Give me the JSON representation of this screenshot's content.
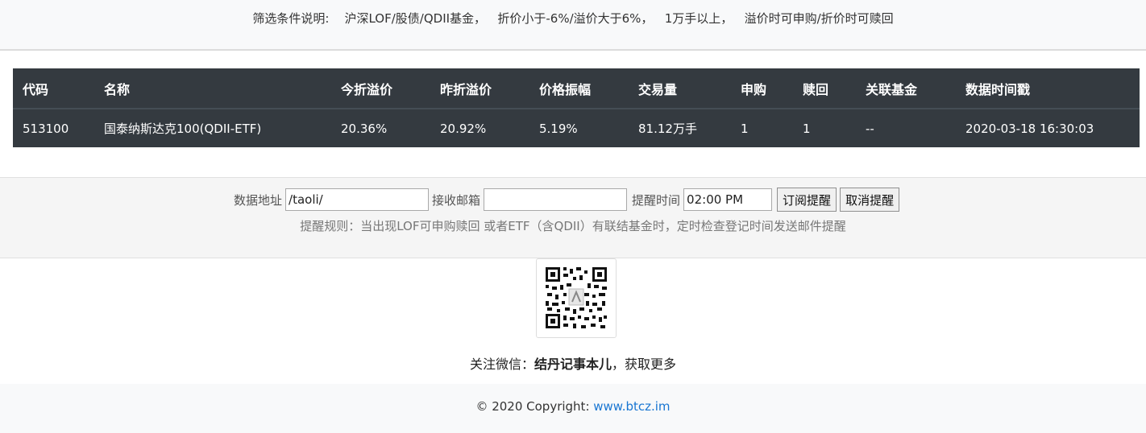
{
  "filter": {
    "label": "筛选条件说明:",
    "items": [
      "沪深LOF/股债/QDII基金，",
      "折价小于-6%/溢价大于6%，",
      "1万手以上，",
      "溢价时可申购/折价时可赎回"
    ]
  },
  "table": {
    "headers": [
      "代码",
      "名称",
      "今折溢价",
      "昨折溢价",
      "价格振幅",
      "交易量",
      "申购",
      "赎回",
      "关联基金",
      "数据时间戳"
    ],
    "rows": [
      [
        "513100",
        "国泰纳斯达克100(QDII-ETF)",
        "20.36%",
        "20.92%",
        "5.19%",
        "81.12万手",
        "1",
        "1",
        "--",
        "2020-03-18 16:30:03"
      ]
    ]
  },
  "alert_form": {
    "data_url_label": "数据地址",
    "data_url_value": "/taoli/",
    "email_label": "接收邮箱",
    "email_value": "",
    "time_label": "提醒时间",
    "time_value": "02:00 PM",
    "subscribe_label": "订阅提醒",
    "cancel_label": "取消提醒",
    "rule_text": "提醒规则：当出现LOF可申购赎回 或者ETF（含QDII）有联结基金时，定时检查登记时间发送邮件提醒"
  },
  "follow": {
    "prefix": "关注微信：",
    "account": "结丹记事本儿",
    "suffix": "，获取更多"
  },
  "footer": {
    "copyright": "© 2020 Copyright: ",
    "link_text": "www.btcz.im"
  },
  "colors": {
    "table_bg": "#343a40",
    "link": "#1976d2",
    "panel_bg": "#f5f5f5"
  }
}
